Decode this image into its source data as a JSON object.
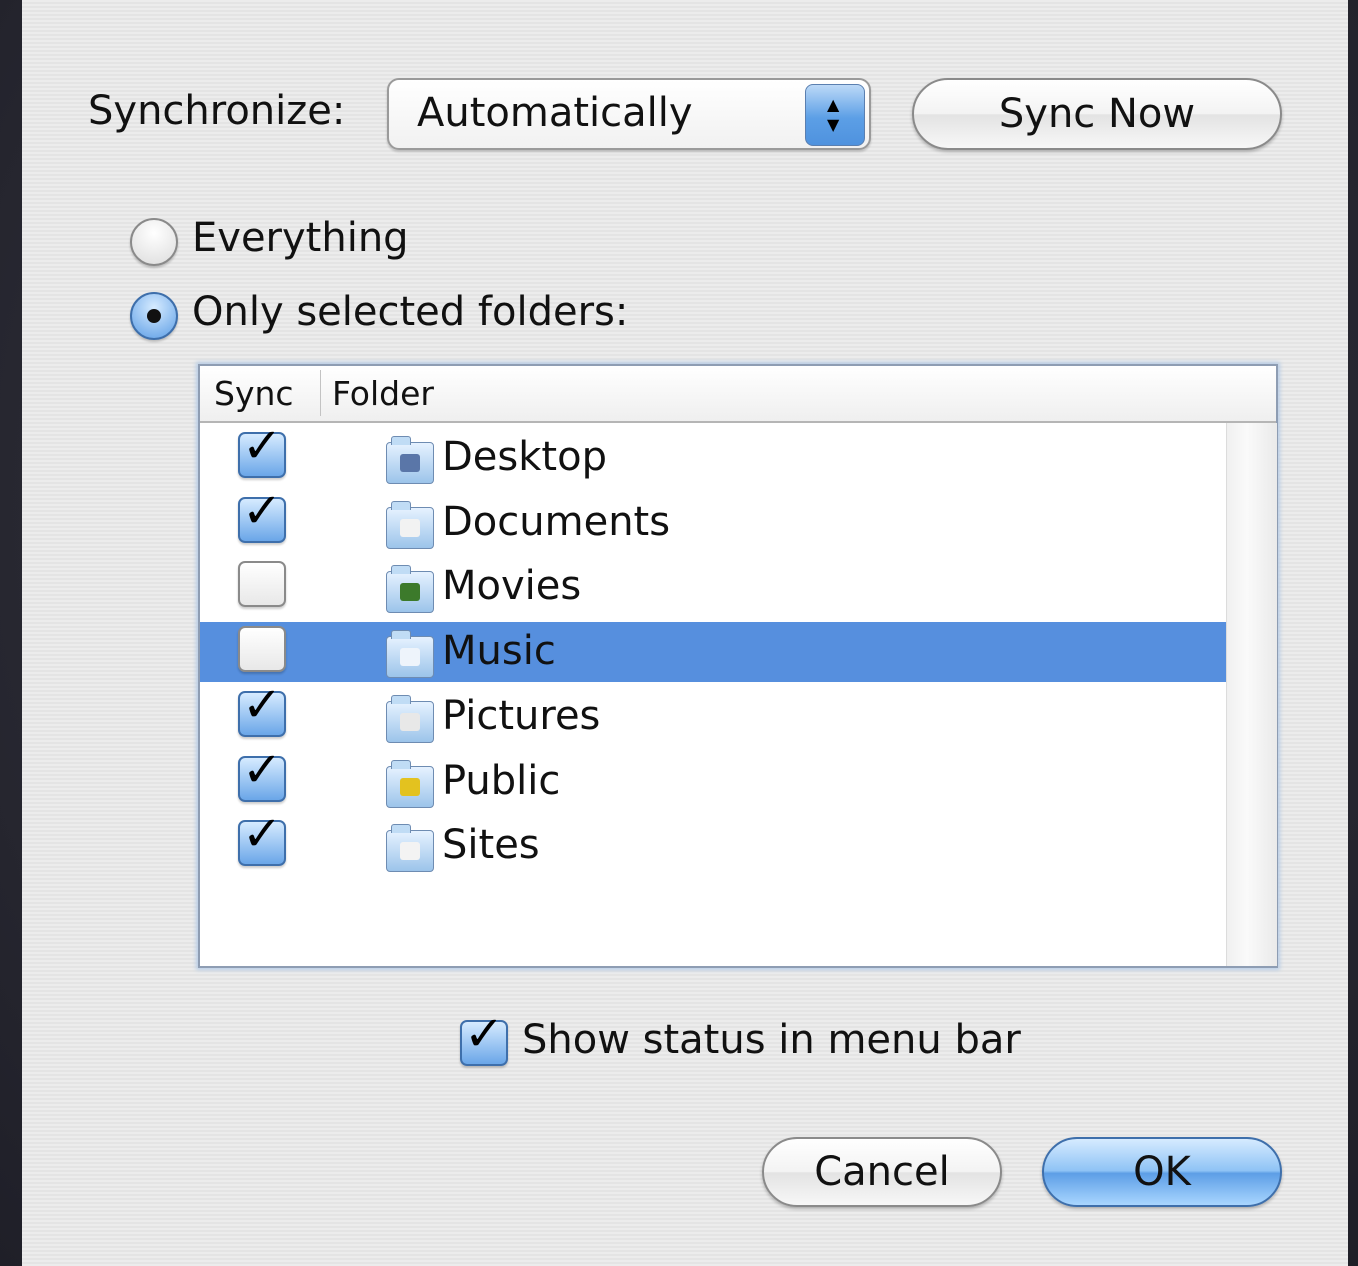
{
  "sync": {
    "label": "Synchronize:",
    "mode": "Automatically",
    "sync_now": "Sync Now"
  },
  "scope": {
    "everything": "Everything",
    "only_selected": "Only selected folders:",
    "selected": "only_selected"
  },
  "table": {
    "col_sync": "Sync",
    "col_folder": "Folder",
    "rows": [
      {
        "name": "Desktop",
        "checked": true,
        "icon": "desktop-folder-icon",
        "emblem_color": "#5a76a8",
        "selected": false
      },
      {
        "name": "Documents",
        "checked": true,
        "icon": "documents-folder-icon",
        "emblem_color": "#f2f2f2",
        "selected": false
      },
      {
        "name": "Movies",
        "checked": false,
        "icon": "movies-folder-icon",
        "emblem_color": "#3c7a2b",
        "selected": false
      },
      {
        "name": "Music",
        "checked": false,
        "icon": "music-folder-icon",
        "emblem_color": "#eef4fb",
        "selected": true
      },
      {
        "name": "Pictures",
        "checked": true,
        "icon": "pictures-folder-icon",
        "emblem_color": "#e8e8e8",
        "selected": false
      },
      {
        "name": "Public",
        "checked": true,
        "icon": "public-folder-icon",
        "emblem_color": "#e3c21f",
        "selected": false
      },
      {
        "name": "Sites",
        "checked": true,
        "icon": "sites-folder-icon",
        "emblem_color": "#f3f3f3",
        "selected": false
      }
    ]
  },
  "status": {
    "label": "Show status in menu bar",
    "checked": true
  },
  "buttons": {
    "cancel": "Cancel",
    "ok": "OK"
  },
  "colors": {
    "selection": "#568fde",
    "accent": "#5d9ee6"
  }
}
